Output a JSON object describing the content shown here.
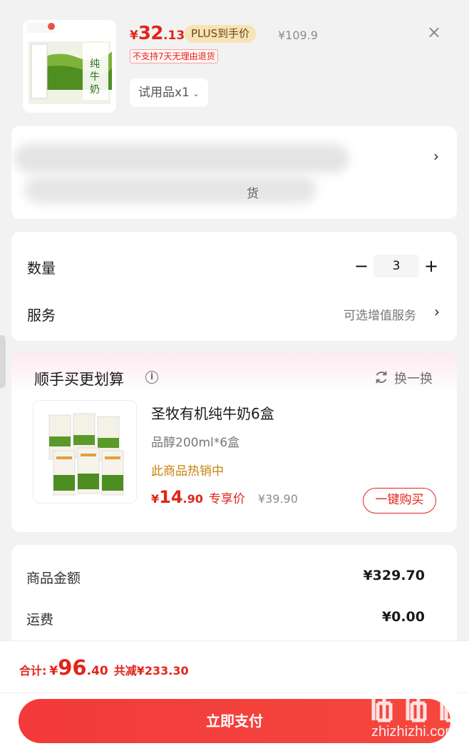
{
  "product": {
    "price_symbol": "¥",
    "price_int": "32",
    "price_dec": ".13",
    "plus_badge": "PLUS到手价",
    "original_price": "¥109.9",
    "no_return_tag": "不支持7天无理由退货",
    "variant": "试用品x1",
    "close_icon": "×"
  },
  "address": {
    "hint_text": "货"
  },
  "quantity": {
    "label": "数量",
    "minus": "−",
    "value": "3",
    "plus": "+"
  },
  "service": {
    "label": "服务",
    "hint": "可选增值服务"
  },
  "recommend": {
    "title": "顺手买更划算",
    "refresh_label": "换一换",
    "item_name": "圣牧有机纯牛奶6盒",
    "item_spec": "品醇200ml*6盒",
    "hot_text": "此商品热销中",
    "price_symbol": "¥",
    "price_int": "14",
    "price_dec": ".90",
    "member_label": "专享价",
    "original_price": "¥39.90",
    "buy_label": "一键购买"
  },
  "summary": {
    "goods_label": "商品金额",
    "goods_value": "¥329.70",
    "shipping_label": "运费",
    "shipping_value": "¥0.00"
  },
  "bottom": {
    "total_label": "合计:",
    "total_symbol": "¥",
    "total_int": "96",
    "total_dec": ".40",
    "total_save": "共减¥233.30",
    "pay_label": "立即支付",
    "watermark": "zhizhizhi.com"
  },
  "colors": {
    "accent": "#e1251b",
    "plus_badge_bg": "#f7e3b5",
    "hot_text": "#c9820c"
  }
}
